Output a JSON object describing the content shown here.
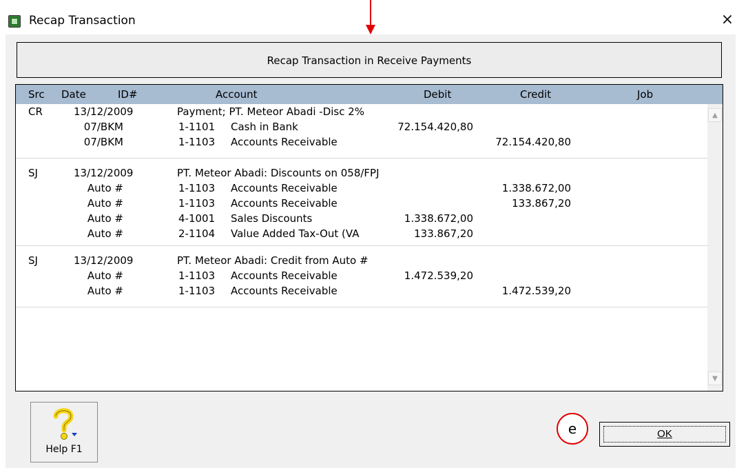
{
  "window": {
    "title": "Recap Transaction",
    "close_glyph": "×"
  },
  "header": {
    "text": "Recap Transaction in Receive Payments"
  },
  "columns": {
    "src": "Src",
    "date": "Date",
    "id": "ID#",
    "account": "Account",
    "debit": "Debit",
    "credit": "Credit",
    "job": "Job"
  },
  "transactions": [
    {
      "src": "CR",
      "date": "13/12/2009",
      "memo": "Payment; PT. Meteor Abadi -Disc 2%",
      "lines": [
        {
          "id": "07/BKM",
          "account": "1-1101",
          "name": "Cash in Bank",
          "debit": "72.154.420,80",
          "credit": ""
        },
        {
          "id": "07/BKM",
          "account": "1-1103",
          "name": "Accounts Receivable",
          "debit": "",
          "credit": "72.154.420,80"
        }
      ]
    },
    {
      "src": "SJ",
      "date": "13/12/2009",
      "memo": "PT. Meteor Abadi:  Discounts on 058/FPJ",
      "lines": [
        {
          "id": "Auto #",
          "account": "1-1103",
          "name": "Accounts Receivable",
          "debit": "",
          "credit": "1.338.672,00"
        },
        {
          "id": "Auto #",
          "account": "1-1103",
          "name": "Accounts Receivable",
          "debit": "",
          "credit": "133.867,20"
        },
        {
          "id": "Auto #",
          "account": "4-1001",
          "name": "Sales Discounts",
          "debit": "1.338.672,00",
          "credit": ""
        },
        {
          "id": "Auto #",
          "account": "2-1104",
          "name": "Value Added Tax-Out (VA",
          "debit": "133.867,20",
          "credit": ""
        }
      ]
    },
    {
      "src": "SJ",
      "date": "13/12/2009",
      "memo": "PT. Meteor Abadi:  Credit from Auto #",
      "lines": [
        {
          "id": "Auto #",
          "account": "1-1103",
          "name": "Accounts Receivable",
          "debit": "1.472.539,20",
          "credit": ""
        },
        {
          "id": "Auto #",
          "account": "1-1103",
          "name": "Accounts Receivable",
          "debit": "",
          "credit": "1.472.539,20"
        }
      ]
    }
  ],
  "scrollbar": {
    "up_glyph": "▲",
    "down_glyph": "▼"
  },
  "buttons": {
    "help_label": "Help F1",
    "ok_label": "OK"
  },
  "annotation": {
    "marker_label": "e",
    "color": "#e00000"
  },
  "colors": {
    "column_header_bg": "#a7bbd1",
    "dialog_bg": "#f0f0f0",
    "help_icon_yellow": "#f5d516",
    "help_icon_blue": "#1a3cc8"
  }
}
